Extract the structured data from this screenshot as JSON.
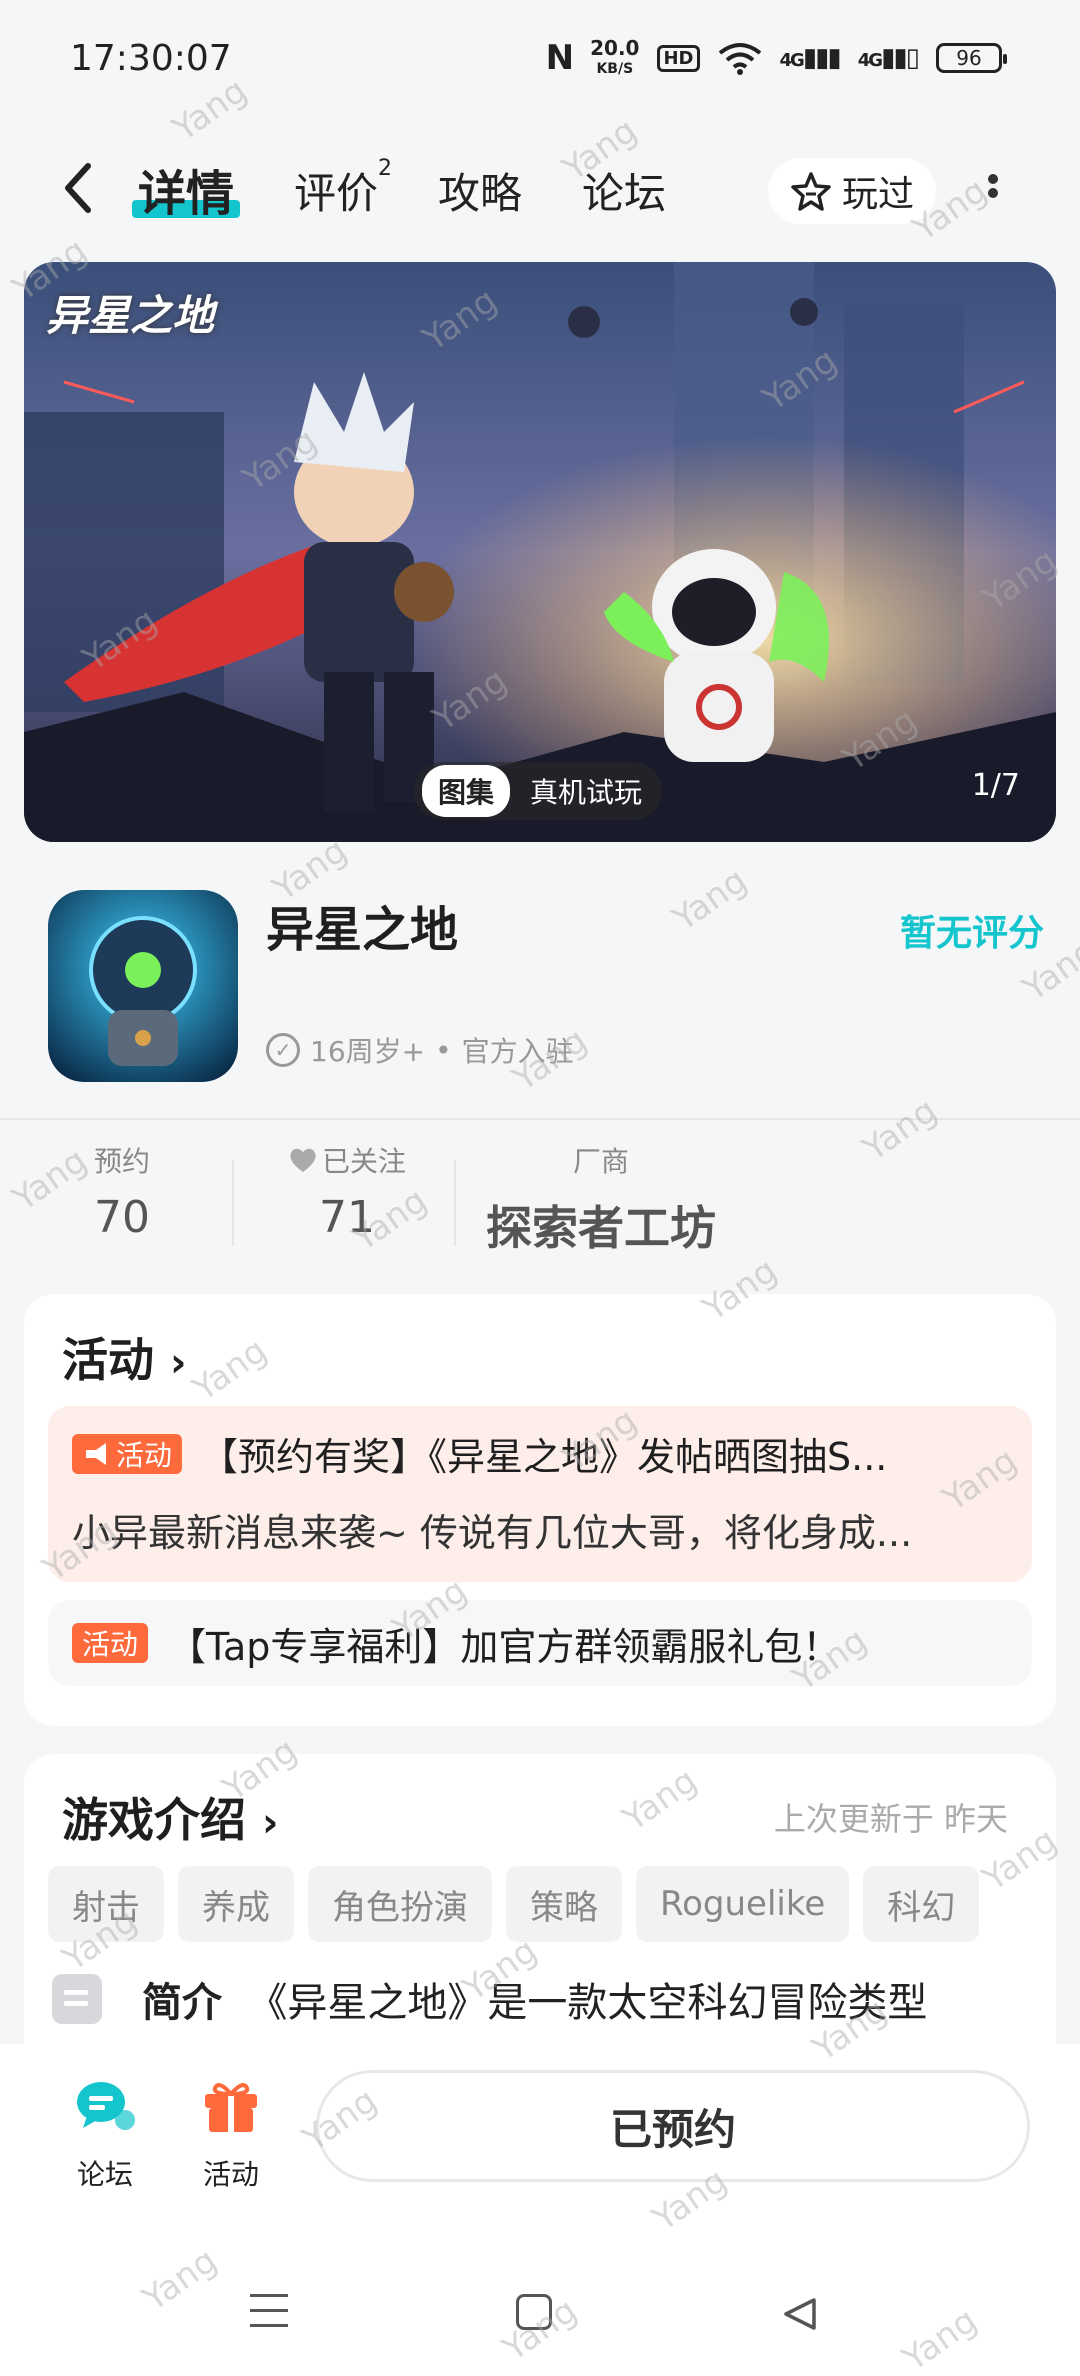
{
  "status_bar": {
    "time": "17:30:07",
    "nfc": "N",
    "net_speed_value": "20.0",
    "net_speed_unit": "KB/S",
    "hd": "HD",
    "signal1": "4G",
    "signal2": "4G",
    "battery": "96"
  },
  "nav": {
    "back_icon": "chevron-left-icon",
    "tabs": [
      {
        "label": "详情",
        "active": true
      },
      {
        "label": "评价",
        "badge": "2"
      },
      {
        "label": "攻略"
      },
      {
        "label": "论坛"
      }
    ],
    "played_label": "玩过"
  },
  "banner": {
    "logo_text": "异星之地",
    "gallery_label": "图集",
    "trial_label": "真机试玩",
    "pager": "1/7"
  },
  "game": {
    "name": "异星之地",
    "rating_text": "暂无评分",
    "age": "16周岁+",
    "official": "官方入驻"
  },
  "stats": {
    "reserve_label": "预约",
    "reserve_value": "70",
    "follow_label": "已关注",
    "follow_value": "71",
    "vendor_label": "厂商",
    "vendor_value": "探索者工坊"
  },
  "activity": {
    "title": "活动",
    "items": [
      {
        "badge": "活动",
        "headline": "【预约有奖】《异星之地》发帖晒图抽S...",
        "desc": "小异最新消息来袭~ 传说有几位大哥，将化身成..."
      },
      {
        "badge": "活动",
        "headline": "【Tap专享福利】加官方群领霸服礼包！"
      }
    ]
  },
  "intro": {
    "title": "游戏介绍",
    "updated": "上次更新于 昨天",
    "tags": [
      "射击",
      "养成",
      "角色扮演",
      "策略",
      "Roguelike",
      "科幻"
    ],
    "summary_label": "简介",
    "summary_text": "《异星之地》是一款太空科幻冒险类型"
  },
  "bottom": {
    "forum_label": "论坛",
    "activity_label": "活动",
    "reserved_label": "已预约"
  },
  "watermark": "Yang",
  "colors": {
    "accent": "#15c5ce",
    "activity_orange": "#ff6a3d",
    "background": "#f5f6f8"
  }
}
